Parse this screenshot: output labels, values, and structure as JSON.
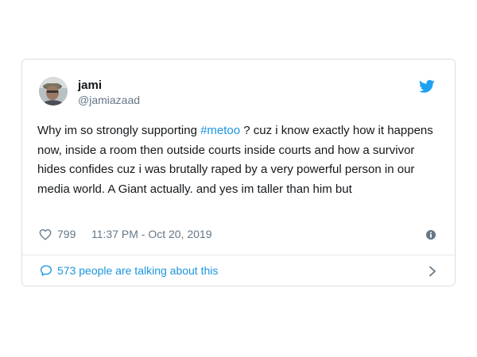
{
  "tweet": {
    "display_name": "jami",
    "handle": "@jamiazaad",
    "text_before_hashtag": "Why im so strongly supporting ",
    "hashtag": "#metoo",
    "text_after_hashtag": " ? cuz i know exactly how it happens now, inside a room then outside courts inside courts and how a survivor hides confides cuz i was brutally raped by a very powerful person in our media world. A Giant actually. and yes im taller than him but",
    "like_count": "799",
    "timestamp": "11:37 PM - Oct 20, 2019",
    "talking_label": "573 people are talking about this"
  },
  "colors": {
    "brand_blue": "#1da1f2",
    "link_blue": "#1b95e0",
    "muted_gray": "#657786",
    "text_dark": "#14171a"
  },
  "icons": {
    "avatar": "profile-photo",
    "brand": "twitter-bird-icon",
    "like": "heart-outline-icon",
    "info": "info-icon",
    "conversation": "speech-bubble-icon",
    "navigate": "chevron-right-icon"
  }
}
